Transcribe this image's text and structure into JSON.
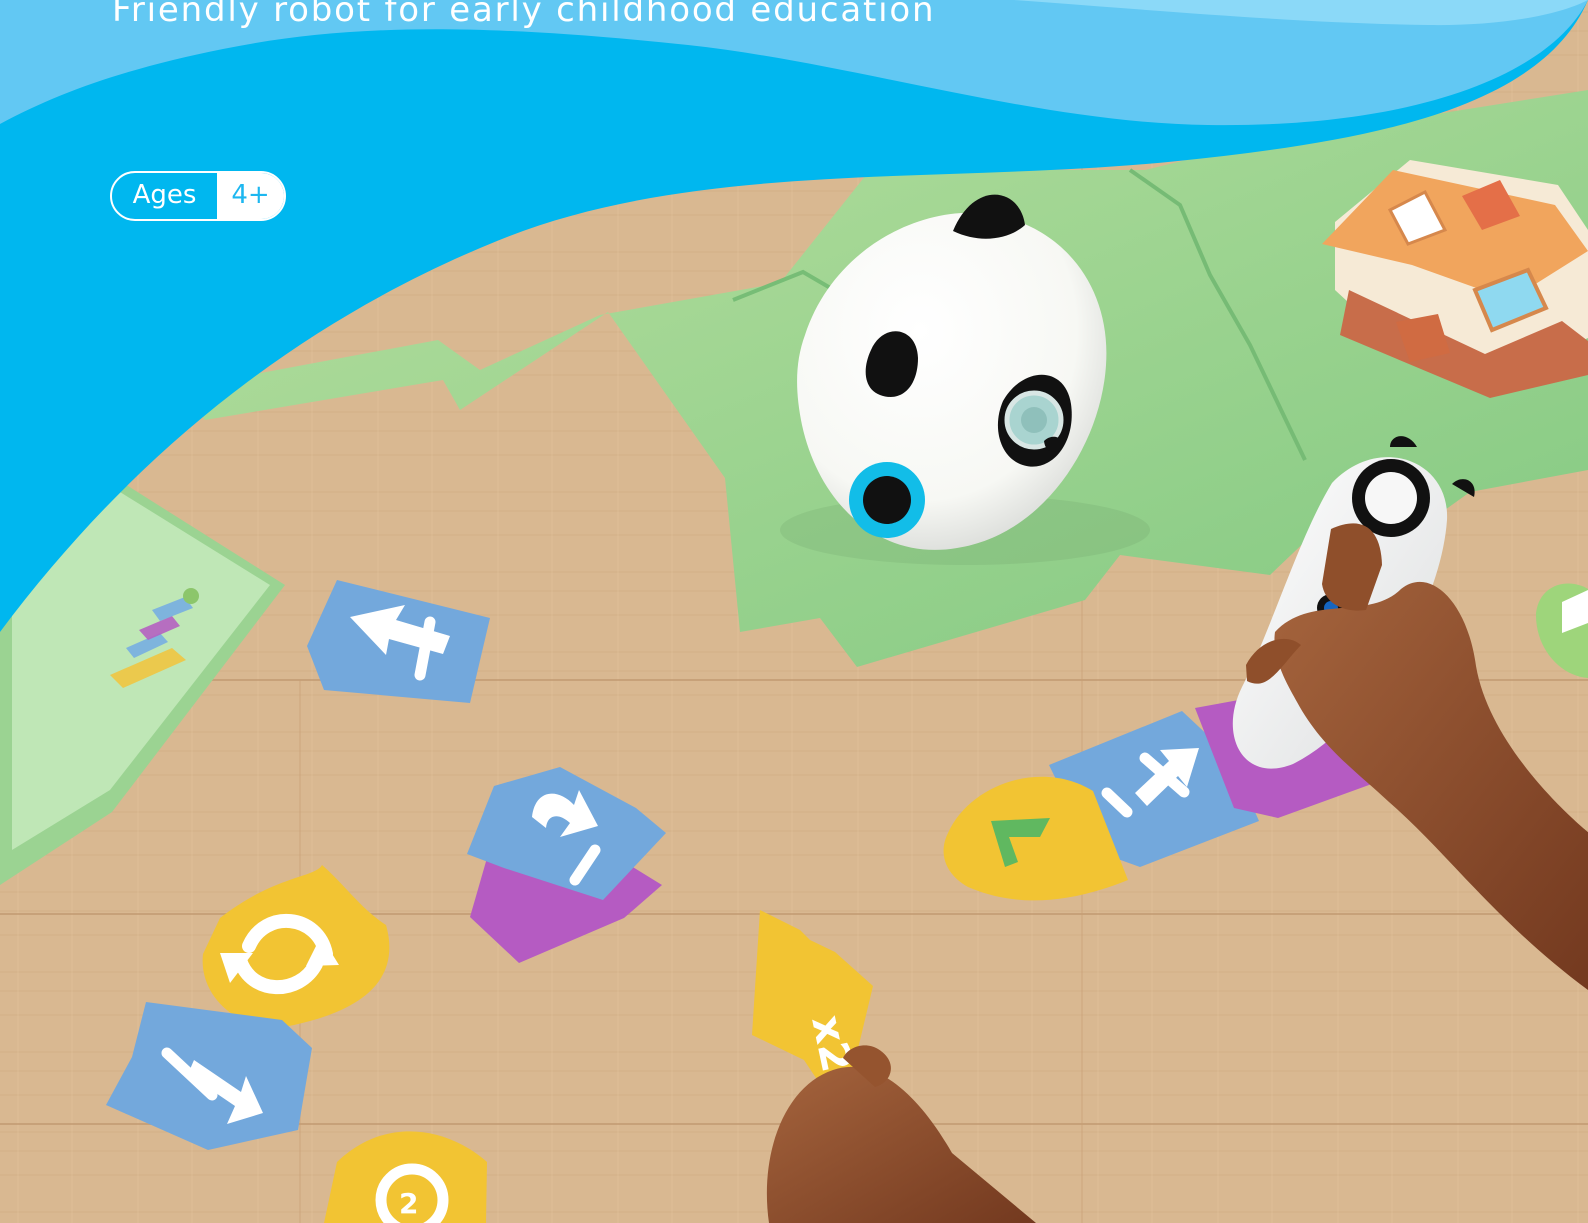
{
  "header": {
    "subtitle": "Friendly robot for early childhood education",
    "age_label": "Ages",
    "age_value": "4+",
    "brand_blue": "#00b7ef",
    "light_blue": "#62c8f3"
  },
  "cards": {
    "yellow_card_text": "x2"
  },
  "colors": {
    "floor": "#d7b690",
    "mat": "#9fd39a",
    "card_blue": "#73a8dc",
    "card_purple": "#b55bc2",
    "card_yellow": "#f2c433",
    "robot_white": "#ffffff"
  }
}
